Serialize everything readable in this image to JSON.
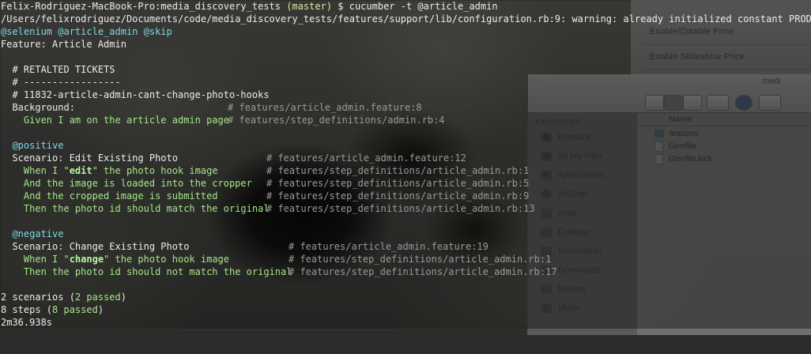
{
  "background": {
    "menu_items": [
      "Enable/Disable Price",
      "Enable Slideshow Price"
    ],
    "finder": {
      "title": "medi",
      "sidebar_header": "FAVORITES",
      "sidebar_items": [
        "Dropbox",
        "All My Files",
        "Applications",
        "AirDrop",
        "code",
        "Desktop",
        "Documents",
        "Downloads",
        "Movies",
        "Music"
      ],
      "column_header": "Name",
      "files": [
        {
          "name": "features",
          "kind": "folder"
        },
        {
          "name": "Gemfile",
          "kind": "file"
        },
        {
          "name": "Gemfile.lock",
          "kind": "file"
        }
      ]
    }
  },
  "terminal": {
    "prompt_host": "Felix-Rodriguez-MacBook-Pro:media_discovery_tests",
    "prompt_branch": "(master)",
    "prompt_cmd": "$ cucumber -t @article_admin",
    "warning": "/Users/felixrodriguez/Documents/code/media_discovery_tests/features/support/lib/configuration.rb:9: warning: already initialized constant PROD",
    "feature_tags": "@selenium @article_admin @skip",
    "feature_title": "Feature: Article Admin",
    "comment_1": "  # RETALTED TICKETS",
    "comment_2": "  # -----------------",
    "comment_3": "  # 11832-article-admin-cant-change-photo-hooks",
    "background_label": "  Background:",
    "background_ref": "# features/article_admin.feature:8",
    "background_step": "    Given I am on the article admin page",
    "background_step_ref": "# features/step_definitions/admin.rb:4",
    "scenario1": {
      "tag": "  @positive",
      "title": "  Scenario: Edit Existing Photo",
      "ref": "# features/article_admin.feature:12",
      "steps": [
        {
          "pre": "    When I \"",
          "arg": "edit",
          "post": "\" the photo hook image",
          "ref": "# features/step_definitions/article_admin.rb:1"
        },
        {
          "pre": "    And the image is loaded into the cropper",
          "arg": "",
          "post": "",
          "ref": "# features/step_definitions/article_admin.rb:5"
        },
        {
          "pre": "    And the cropped image is submitted",
          "arg": "",
          "post": "",
          "ref": "# features/step_definitions/article_admin.rb:9"
        },
        {
          "pre": "    Then the photo id should match the original",
          "arg": "",
          "post": "",
          "ref": "# features/step_definitions/article_admin.rb:13"
        }
      ]
    },
    "scenario2": {
      "tag": "  @negative",
      "title": "  Scenario: Change Existing Photo",
      "ref": "# features/article_admin.feature:19",
      "steps": [
        {
          "pre": "    When I \"",
          "arg": "change",
          "post": "\" the photo hook image",
          "ref": "# features/step_definitions/article_admin.rb:1"
        },
        {
          "pre": "    Then the photo id should not match the original",
          "arg": "",
          "post": "",
          "ref": "# features/step_definitions/article_admin.rb:17"
        }
      ]
    },
    "summary_scenarios_pre": "2 scenarios (",
    "summary_scenarios_passed": "2 passed",
    "summary_scenarios_post": ")",
    "summary_steps_pre": "8 steps (",
    "summary_steps_passed": "8 passed",
    "summary_steps_post": ")",
    "duration": "2m36.938s"
  },
  "colors": {
    "text": "#ececec",
    "passed_green": "#a6e68a",
    "comment_gray": "#9a9a9a",
    "tag_cyan": "#7fd8e6",
    "branch_yellow": "#e5e5a0"
  }
}
